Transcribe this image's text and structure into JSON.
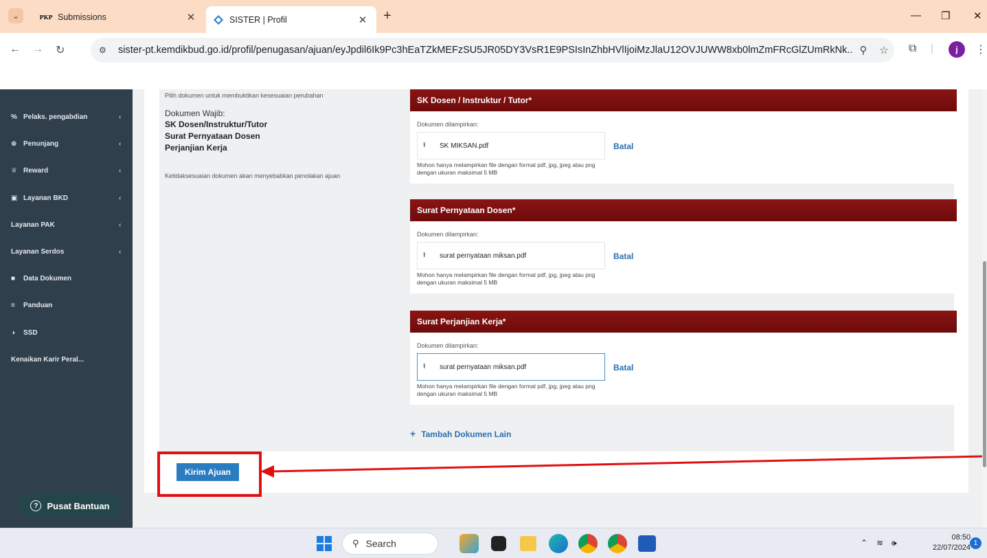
{
  "browser": {
    "tabs": [
      {
        "favicon": "pkp-logo",
        "favicon_text": "PKP",
        "title": "Submissions"
      },
      {
        "favicon": "sister-logo",
        "title": "SISTER | Profil"
      }
    ],
    "url": "sister-pt.kemdikbud.go.id/profil/penugasan/ajuan/eyJpdil6Ik9Pc3hEaTZkMEFzSU5JR05DY3VsR1E9PSIsInZhbHVlIjoiMzJlaU12OVJUWW8xb0lmZmFRcGlZUmRkNk...",
    "profile_initial": "j"
  },
  "sidebar": {
    "items": [
      {
        "icon": "percent-icon",
        "label": "Pelaks. pengabdian",
        "chevron": true
      },
      {
        "icon": "plus-circle-icon",
        "label": "Penunjang",
        "chevron": true
      },
      {
        "icon": "trophy-icon",
        "label": "Reward",
        "chevron": true
      },
      {
        "icon": "briefcase-icon",
        "label": "Layanan BKD",
        "chevron": true
      },
      {
        "icon": "",
        "label": "Layanan PAK",
        "chevron": true
      },
      {
        "icon": "",
        "label": "Layanan Serdos",
        "chevron": true
      },
      {
        "icon": "folder-icon",
        "label": "Data Dokumen",
        "chevron": false
      },
      {
        "icon": "list-icon",
        "label": "Panduan",
        "chevron": false
      },
      {
        "icon": "half-circle-icon",
        "label": "SSD",
        "chevron": false
      },
      {
        "icon": "",
        "label": "Kenaikan Karir Peral...",
        "chevron": false
      }
    ],
    "help_label": "Pusat Bantuan"
  },
  "left_panel": {
    "hint": "Pilih dokumen untuk membuktikan kesesuaian perubahan",
    "required_title": "Dokumen Wajib:",
    "required_docs": [
      "SK Dosen/Instruktur/Tutor",
      "Surat Pernyataan Dosen",
      "Perjanjian Kerja"
    ],
    "warning": "Ketidaksesuaian dokumen akan menyebabkan penolakan ajuan"
  },
  "documents": [
    {
      "header": "SK Dosen / Instruktur / Tutor*",
      "attached_label": "Dokumen dilampirkan:",
      "file_name": "SK MIKSAN.pdf",
      "cancel": "Batal",
      "note": "Mohon hanya melampirkan file dengan format pdf, jpg, jpeg atau png dengan ukuran maksimal 5 MB"
    },
    {
      "header": "Surat Pernyataan Dosen*",
      "attached_label": "Dokumen dilampirkan:",
      "file_name": "surat pernyataan miksan.pdf",
      "cancel": "Batal",
      "note": "Mohon hanya melampirkan file dengan format pdf, jpg, jpeg atau png dengan ukuran maksimal 5 MB"
    },
    {
      "header": "Surat Perjanjian Kerja*",
      "attached_label": "Dokumen dilampirkan:",
      "file_name": "surat pernyataan miksan.pdf",
      "cancel": "Batal",
      "note": "Mohon hanya melampirkan file dengan format pdf, jpg, jpeg atau png dengan ukuran maksimal 5 MB"
    }
  ],
  "add_document_label": "Tambah Dokumen Lain",
  "submit_label": "Kirim Ajuan",
  "colors": {
    "accent_red": "#7a0f0f",
    "link_blue": "#2a6fb0",
    "sidebar_bg": "#2f3f4c",
    "annotation_red": "#e01010"
  },
  "taskbar": {
    "search_placeholder": "Search",
    "time": "08:50",
    "date": "22/07/2024",
    "notification_count": "1"
  }
}
